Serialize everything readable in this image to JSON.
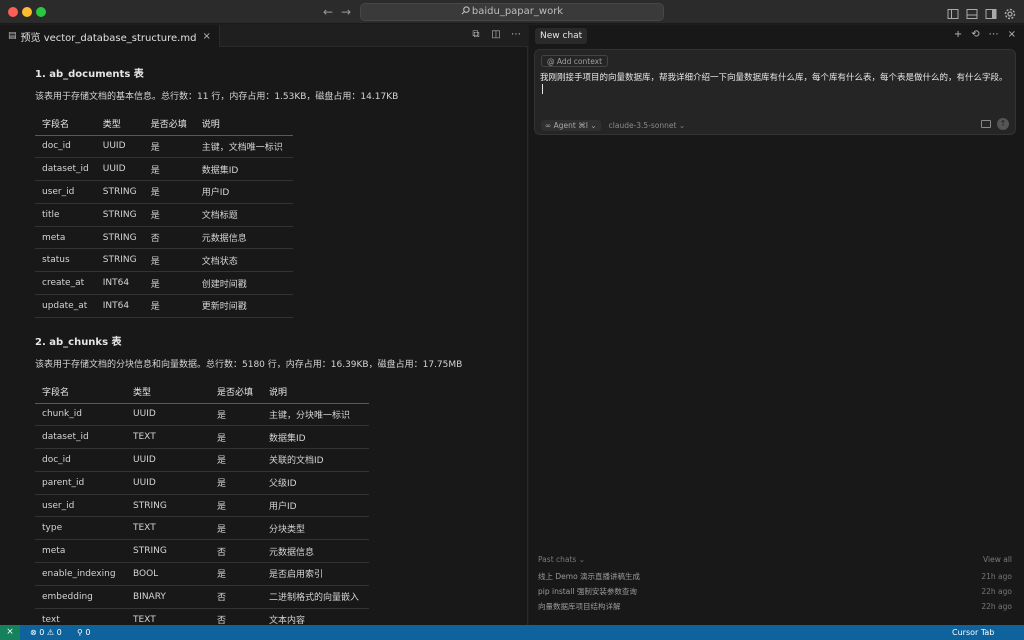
{
  "titlebar": {
    "search_text": "baidu_papar_work",
    "back_arrow": "←",
    "forward_arrow": "→",
    "layout_icons": [
      "sidebar-left-icon",
      "panel-bottom-icon",
      "sidebar-right-icon",
      "settings-icon"
    ]
  },
  "editor": {
    "tab_label": "预览 vector_database_structure.md",
    "tab_close": "×",
    "sections": [
      {
        "heading": "1. ab_documents 表",
        "description": "该表用于存储文档的基本信息。总行数：11 行，内存占用：1.53KB，磁盘占用：14.17KB",
        "columns": [
          "字段名",
          "类型",
          "是否必填",
          "说明"
        ],
        "rows": [
          [
            "doc_id",
            "UUID",
            "是",
            "主键，文档唯一标识"
          ],
          [
            "dataset_id",
            "UUID",
            "是",
            "数据集ID"
          ],
          [
            "user_id",
            "STRING",
            "是",
            "用户ID"
          ],
          [
            "title",
            "STRING",
            "是",
            "文档标题"
          ],
          [
            "meta",
            "STRING",
            "否",
            "元数据信息"
          ],
          [
            "status",
            "STRING",
            "是",
            "文档状态"
          ],
          [
            "create_at",
            "INT64",
            "是",
            "创建时间戳"
          ],
          [
            "update_at",
            "INT64",
            "是",
            "更新时间戳"
          ]
        ]
      },
      {
        "heading": "2. ab_chunks 表",
        "description": "该表用于存储文档的分块信息和向量数据。总行数：5180 行，内存占用：16.39KB，磁盘占用：17.75MB",
        "columns": [
          "字段名",
          "类型",
          "是否必填",
          "说明"
        ],
        "rows": [
          [
            "chunk_id",
            "UUID",
            "是",
            "主键，分块唯一标识"
          ],
          [
            "dataset_id",
            "TEXT",
            "是",
            "数据集ID"
          ],
          [
            "doc_id",
            "UUID",
            "是",
            "关联的文档ID"
          ],
          [
            "parent_id",
            "UUID",
            "是",
            "父级ID"
          ],
          [
            "user_id",
            "STRING",
            "是",
            "用户ID"
          ],
          [
            "type",
            "TEXT",
            "是",
            "分块类型"
          ],
          [
            "meta",
            "STRING",
            "否",
            "元数据信息"
          ],
          [
            "enable_indexing",
            "BOOL",
            "是",
            "是否启用索引"
          ],
          [
            "embedding",
            "BINARY",
            "否",
            "二进制格式的向量嵌入"
          ],
          [
            "text",
            "TEXT",
            "否",
            "文本内容"
          ]
        ]
      }
    ]
  },
  "chat": {
    "tab_label": "New chat",
    "actions": [
      "+",
      "⟲",
      "⋯",
      "×"
    ],
    "add_context": "Add context",
    "input_text": "我刚刚接手项目的向量数据库，帮我详细介绍一下向量数据库有什么库，每个库有什么表，每个表是做什么的，有什么字段。",
    "mode": "Agent",
    "mode_shortcut": "⌘I",
    "model": "claude-3.5-sonnet",
    "past_chats_label": "Past chats",
    "view_all": "View all",
    "past_chats": [
      {
        "title": "线上 Demo 演示直播讲稿生成",
        "ago": "21h ago"
      },
      {
        "title": "pip install 强制安装参数查询",
        "ago": "22h ago"
      },
      {
        "title": "向量数据库项目结构详解",
        "ago": "22h ago"
      }
    ]
  },
  "statusbar": {
    "remote_icon": "⨯",
    "problems": "⊗ 0 ⚠ 0",
    "ports": "⚲ 0",
    "right_label": "Cursor Tab"
  }
}
